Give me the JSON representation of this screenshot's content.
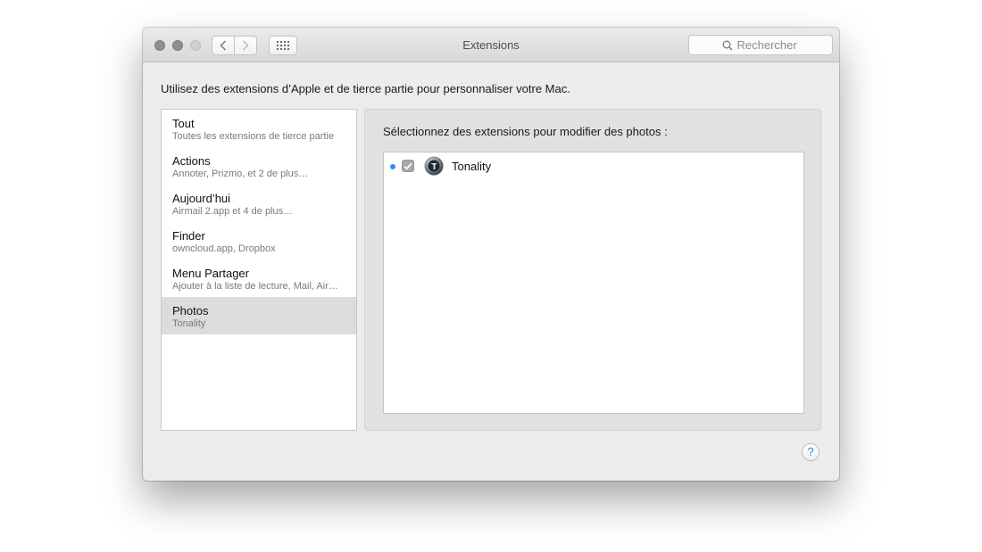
{
  "window": {
    "title": "Extensions"
  },
  "toolbar": {
    "back_icon": "chevron-left-icon",
    "forward_icon": "chevron-right-icon",
    "grid_icon": "grid-icon"
  },
  "search": {
    "placeholder": "Rechercher",
    "value": ""
  },
  "intro_text": "Utilisez des extensions d’Apple et de tierce partie pour personnaliser votre Mac.",
  "categories": [
    {
      "name": "Tout",
      "subtitle": "Toutes les extensions de tierce partie",
      "selected": false
    },
    {
      "name": "Actions",
      "subtitle": "Annoter, Prizmo, et 2 de plus…",
      "selected": false
    },
    {
      "name": "Aujourd’hui",
      "subtitle": "Airmail 2.app et 4 de plus…",
      "selected": false
    },
    {
      "name": "Finder",
      "subtitle": "owncloud.app, Dropbox",
      "selected": false
    },
    {
      "name": "Menu Partager",
      "subtitle": "Ajouter à la liste de lecture, Mail, Air…",
      "selected": false
    },
    {
      "name": "Photos",
      "subtitle": "Tonality",
      "selected": true
    }
  ],
  "panel": {
    "heading": "Sélectionnez des extensions pour modifier des photos :",
    "extensions": [
      {
        "name": "Tonality",
        "checked": true,
        "new": true,
        "icon": "tonality-app-icon"
      }
    ]
  },
  "help": {
    "label": "?"
  },
  "colors": {
    "accent": "#2f8ef6",
    "selection": "#dcdcdc",
    "window_bg": "#ececec"
  }
}
